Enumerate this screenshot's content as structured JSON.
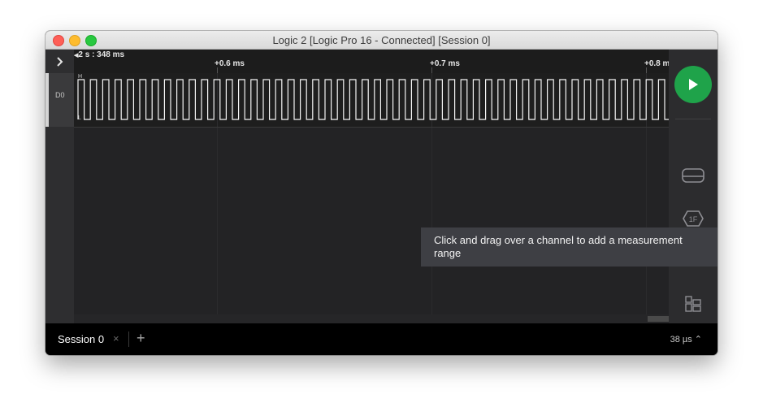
{
  "window": {
    "title": "Logic 2 [Logic Pro 16 - Connected] [Session 0]"
  },
  "timeline": {
    "origin_label": "2 s : 348 ms",
    "ticks": [
      "+0.6 ms",
      "+0.7 ms",
      "+0.8 m"
    ]
  },
  "channels": [
    {
      "label": "D0",
      "high_marker": "H",
      "low_marker": "L"
    }
  ],
  "tooltip": {
    "text": "Click and drag over a channel to add a measurement range"
  },
  "statusbar": {
    "session_tab": "Session 0",
    "close_glyph": "×",
    "add_glyph": "+",
    "right_text": "38 µs ⌃"
  },
  "icons": {
    "expand": "chevron-right-icon",
    "play": "play-icon",
    "analyzers": "analyzers-icon",
    "trigger": "hex-1f-icon",
    "measure": "measurement-icon",
    "extensions": "extensions-icon",
    "notes": "comment-icon"
  },
  "colors": {
    "accent": "#1fa34a",
    "waveform": "#f5f5f5",
    "background": "#1e1e1e"
  }
}
